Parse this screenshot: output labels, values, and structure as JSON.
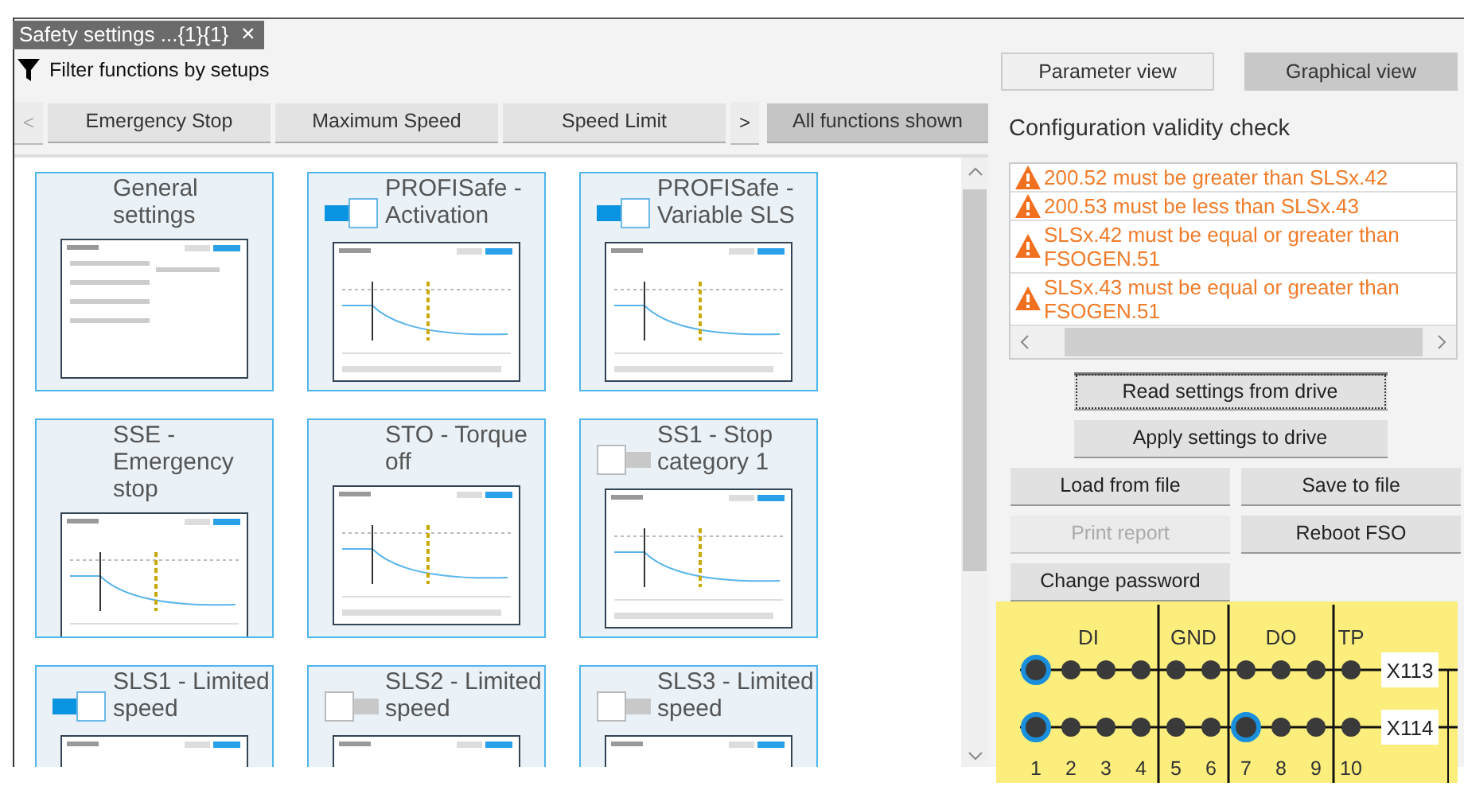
{
  "document_tab": {
    "title": "Safety settings ...{1}{1}",
    "close": "×"
  },
  "filter": {
    "label": "Filter functions by setups"
  },
  "filter_bar": {
    "prev": {
      "label": "<",
      "disabled": true
    },
    "next": {
      "label": ">",
      "disabled": false
    },
    "items": [
      {
        "label": "Emergency Stop",
        "selected": false
      },
      {
        "label": "Maximum Speed",
        "selected": false
      },
      {
        "label": "Speed Limit",
        "selected": false
      }
    ],
    "show_all": {
      "label": "All functions shown",
      "selected": true
    }
  },
  "function_cards": [
    {
      "title": "General settings",
      "kind": "plain"
    },
    {
      "title": "PROFISafe - Activation",
      "kind": "switch",
      "on": true
    },
    {
      "title": "PROFISafe - Variable SLS",
      "kind": "switch",
      "on": true
    },
    {
      "title": "SSE - Emergency stop",
      "kind": "plain"
    },
    {
      "title": "STO - Torque off",
      "kind": "plain"
    },
    {
      "title": "SS1 - Stop category 1",
      "kind": "switch",
      "on": false
    },
    {
      "title": "SLS1 - Limited speed",
      "kind": "switch",
      "on": true
    },
    {
      "title": "SLS2 - Limited speed",
      "kind": "switch",
      "on": false
    },
    {
      "title": "SLS3 - Limited speed",
      "kind": "switch",
      "on": false
    }
  ],
  "view_tabs": [
    {
      "label": "Parameter view",
      "selected": false
    },
    {
      "label": "Graphical view",
      "selected": true
    }
  ],
  "validity_check": {
    "title": "Configuration validity check",
    "messages": [
      "200.52 must be greater than SLSx.42",
      "200.53 must be less than SLSx.43",
      "SLSx.42 must be equal or greater than FSOGEN.51",
      "SLSx.43 must be equal or greater than FSOGEN.51"
    ]
  },
  "action_buttons": [
    {
      "label": "Read settings from drive",
      "kind": "wide",
      "disabled": false,
      "focused": true
    },
    {
      "label": "Apply settings to drive",
      "kind": "wide",
      "disabled": false,
      "focused": false
    },
    {
      "label": "Load from file",
      "kind": "half",
      "disabled": false,
      "focused": false
    },
    {
      "label": "Save to file",
      "kind": "half",
      "disabled": false,
      "focused": false
    },
    {
      "label": "Print report",
      "kind": "half",
      "disabled": true,
      "focused": false
    },
    {
      "label": "Reboot FSO",
      "kind": "half",
      "disabled": false,
      "focused": false
    },
    {
      "label": "Change password",
      "kind": "half",
      "disabled": false,
      "focused": false
    }
  ],
  "connector": {
    "groups": [
      {
        "label": "DI",
        "pins": [
          "1",
          "2",
          "3",
          "4"
        ]
      },
      {
        "label": "GND",
        "pins": [
          "5",
          "6"
        ]
      },
      {
        "label": "DO",
        "pins": [
          "7",
          "8",
          "9"
        ]
      },
      {
        "label": "TP",
        "pins": [
          "10"
        ]
      }
    ],
    "rows": [
      {
        "label": "X113",
        "pins": [
          {
            "active": true
          },
          {
            "active": false
          },
          {
            "active": false
          },
          {
            "active": false
          },
          {
            "active": false
          },
          {
            "active": false
          },
          {
            "active": false
          },
          {
            "active": false
          },
          {
            "active": false
          },
          {
            "active": false
          }
        ]
      },
      {
        "label": "X114",
        "pins": [
          {
            "active": true
          },
          {
            "active": false
          },
          {
            "active": false
          },
          {
            "active": false
          },
          {
            "active": false
          },
          {
            "active": false
          },
          {
            "active": true
          },
          {
            "active": false
          },
          {
            "active": false
          },
          {
            "active": false
          }
        ]
      }
    ]
  }
}
